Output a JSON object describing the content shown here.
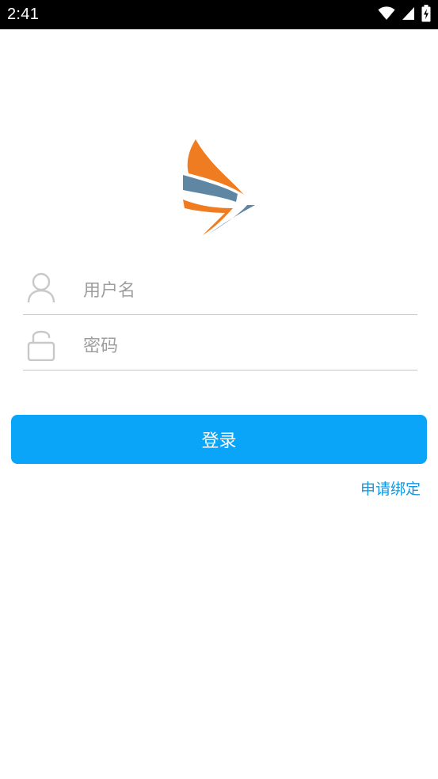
{
  "status_bar": {
    "time": "2:41",
    "icons": [
      "wifi-icon",
      "cell-signal-icon",
      "battery-charging-icon"
    ]
  },
  "logo": {
    "icon": "brand-logo",
    "colors": {
      "orange": "#f07c22",
      "steel": "#5f87a3"
    }
  },
  "form": {
    "username": {
      "icon": "user-icon",
      "placeholder": "用户名",
      "value": ""
    },
    "password": {
      "icon": "lock-icon",
      "placeholder": "密码",
      "value": ""
    }
  },
  "actions": {
    "login_label": "登录",
    "bind_label": "申请绑定"
  },
  "colors": {
    "accent": "#0aa4f9",
    "link": "#1497e3",
    "icon_gray": "#c8c8c8",
    "divider": "#c6c6c6"
  }
}
